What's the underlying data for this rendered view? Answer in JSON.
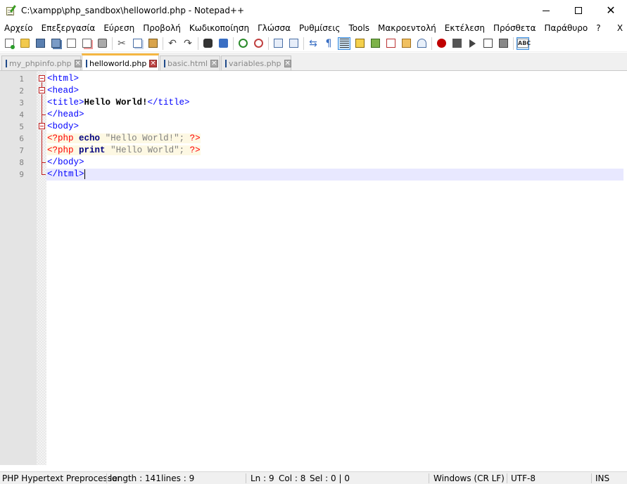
{
  "window": {
    "title": "C:\\xampp\\php_sandbox\\helloworld.php - Notepad++",
    "minimize_label": "",
    "maximize_label": "",
    "close_label": "✕"
  },
  "menu": {
    "items": [
      "Αρχείο",
      "Επεξεργασία",
      "Εύρεση",
      "Προβολή",
      "Κωδικοποίηση",
      "Γλώσσα",
      "Ρυθμίσεις",
      "Tools",
      "Μακροεντολή",
      "Εκτέλεση",
      "Πρόσθετα",
      "Παράθυρο",
      "?"
    ],
    "close_doc": "X"
  },
  "toolbar": {
    "icons": [
      "new-file-icon",
      "open-file-icon",
      "save-icon",
      "save-all-icon",
      "close-icon",
      "close-all-icon",
      "print-icon",
      "cut-icon",
      "copy-icon",
      "paste-icon",
      "undo-icon",
      "redo-icon",
      "find-icon",
      "replace-icon",
      "zoom-in-icon",
      "zoom-out-icon",
      "sync-vertical-icon",
      "sync-horizontal-icon",
      "word-wrap-icon",
      "show-all-chars-icon",
      "indent-guide-icon",
      "user-language-icon",
      "document-map-icon",
      "function-list-icon",
      "folder-workspace-icon",
      "document-monitor-icon",
      "record-macro-icon",
      "stop-macro-icon",
      "play-macro-icon",
      "play-macro-multiple-icon",
      "save-macro-icon",
      "spell-check-icon"
    ],
    "pilcrow": "¶",
    "spell_text": "ABC"
  },
  "tabs": [
    {
      "label": "my_phpinfo.php",
      "active": false
    },
    {
      "label": "helloworld.php",
      "active": true
    },
    {
      "label": "basic.html",
      "active": false
    },
    {
      "label": "variables.php",
      "active": false
    }
  ],
  "tab_close_glyph": "✕",
  "editor": {
    "line_numbers": [
      "1",
      "2",
      "3",
      "4",
      "5",
      "6",
      "7",
      "8",
      "9"
    ],
    "lines": [
      [
        {
          "t": "tag",
          "v": "<html>"
        }
      ],
      [
        {
          "t": "tag",
          "v": "<head>"
        }
      ],
      [
        {
          "t": "tag",
          "v": "<title>"
        },
        {
          "t": "text",
          "v": "Hello World!"
        },
        {
          "t": "tag",
          "v": "</title>"
        }
      ],
      [
        {
          "t": "tag",
          "v": "</head>"
        }
      ],
      [
        {
          "t": "tag",
          "v": "<body>"
        }
      ],
      [
        {
          "t": "php",
          "v": "<?php"
        },
        {
          "t": "plain",
          "v": " "
        },
        {
          "t": "kw",
          "v": "echo"
        },
        {
          "t": "plain",
          "v": " "
        },
        {
          "t": "str",
          "v": "\"Hello World!\""
        },
        {
          "t": "punct",
          "v": ";"
        },
        {
          "t": "plain",
          "v": " "
        },
        {
          "t": "php",
          "v": "?>"
        }
      ],
      [
        {
          "t": "php",
          "v": "<?php"
        },
        {
          "t": "plain",
          "v": " "
        },
        {
          "t": "kw",
          "v": "print"
        },
        {
          "t": "plain",
          "v": " "
        },
        {
          "t": "str",
          "v": "\"Hello World\""
        },
        {
          "t": "punct",
          "v": ";"
        },
        {
          "t": "plain",
          "v": " "
        },
        {
          "t": "php",
          "v": "?>"
        }
      ],
      [
        {
          "t": "tag",
          "v": "</body>"
        }
      ],
      [
        {
          "t": "tag",
          "v": "</html>"
        }
      ]
    ],
    "current_line": 9
  },
  "status": {
    "language": "PHP Hypertext Preprocessor",
    "length": "length : 141",
    "lines": "lines : 9",
    "ln": "Ln : 9",
    "col": "Col : 8",
    "sel": "Sel : 0 | 0",
    "eol": "Windows (CR LF)",
    "encoding": "UTF-8",
    "mode": "INS"
  },
  "colors": {
    "tag": "#0000ff",
    "php_delim": "#ff0000",
    "keyword": "#000080",
    "string": "#808080",
    "fold_marker": "#c02020",
    "current_line_bg": "#e8e8ff",
    "tab_active_accent": "#f5b642"
  }
}
